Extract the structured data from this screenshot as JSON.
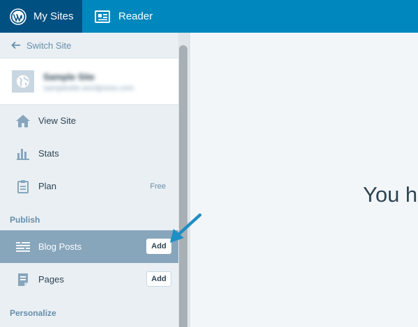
{
  "masterbar": {
    "my_sites_label": "My Sites",
    "reader_label": "Reader",
    "colors": {
      "bar": "#0087be",
      "active_tab": "#005082"
    }
  },
  "sidebar": {
    "switch_site_label": "Switch Site",
    "site": {
      "title": "Sample Site",
      "url": "samplesite.wordpress.com"
    },
    "items": [
      {
        "label": "View Site",
        "icon": "home-icon"
      },
      {
        "label": "Stats",
        "icon": "stats-icon"
      },
      {
        "label": "Plan",
        "icon": "clipboard-icon",
        "badge": "Free"
      }
    ],
    "publish_heading": "Publish",
    "publish_items": [
      {
        "label": "Blog Posts",
        "icon": "posts-icon",
        "action": "Add",
        "selected": true
      },
      {
        "label": "Pages",
        "icon": "page-icon",
        "action": "Add"
      }
    ],
    "personalize_heading": "Personalize",
    "colors": {
      "selected_bg": "#87a6bc",
      "text": "#2e4453",
      "muted": "#668eaa"
    }
  },
  "main": {
    "partial_text": "You h"
  },
  "annotation": {
    "arrow_color": "#1f8ec4"
  }
}
